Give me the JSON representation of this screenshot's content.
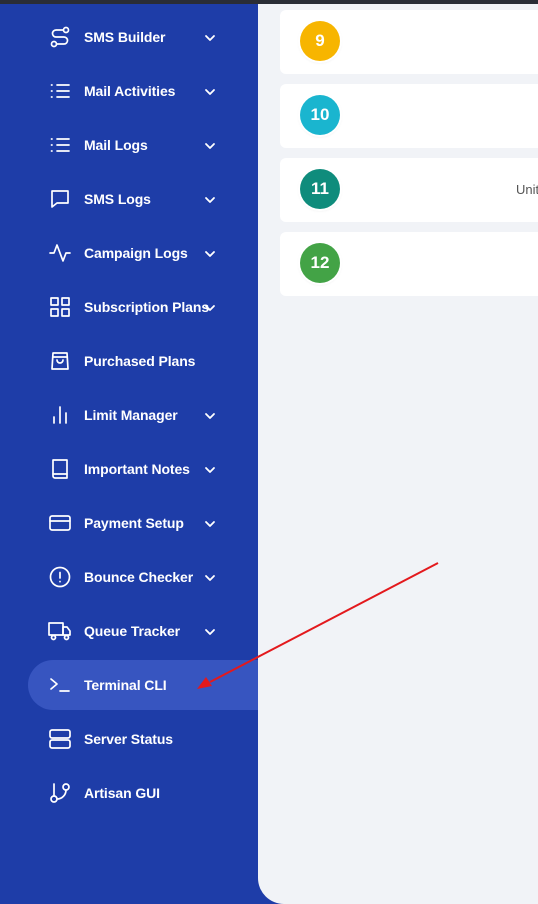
{
  "sidebar": {
    "items": [
      {
        "label": "SMS Builder",
        "icon": "route-icon",
        "has_chevron": true,
        "active": false
      },
      {
        "label": "Mail Activities",
        "icon": "list-icon",
        "has_chevron": true,
        "active": false
      },
      {
        "label": "Mail Logs",
        "icon": "list-icon",
        "has_chevron": true,
        "active": false
      },
      {
        "label": "SMS Logs",
        "icon": "message-square-icon",
        "has_chevron": true,
        "active": false
      },
      {
        "label": "Campaign Logs",
        "icon": "activity-icon",
        "has_chevron": true,
        "active": false
      },
      {
        "label": "Subscription Plans",
        "icon": "grid-icon",
        "has_chevron": true,
        "active": false
      },
      {
        "label": "Purchased Plans",
        "icon": "shopping-bag-icon",
        "has_chevron": false,
        "active": false
      },
      {
        "label": "Limit Manager",
        "icon": "bar-chart-icon",
        "has_chevron": true,
        "active": false
      },
      {
        "label": "Important Notes",
        "icon": "book-icon",
        "has_chevron": true,
        "active": false
      },
      {
        "label": "Payment Setup",
        "icon": "credit-card-icon",
        "has_chevron": true,
        "active": false
      },
      {
        "label": "Bounce Checker",
        "icon": "alert-circle-icon",
        "has_chevron": true,
        "active": false
      },
      {
        "label": "Queue Tracker",
        "icon": "truck-icon",
        "has_chevron": true,
        "active": false
      },
      {
        "label": "Terminal CLI",
        "icon": "terminal-icon",
        "has_chevron": false,
        "active": true
      },
      {
        "label": "Server Status",
        "icon": "server-icon",
        "has_chevron": false,
        "active": false
      },
      {
        "label": "Artisan GUI",
        "icon": "git-branch-icon",
        "has_chevron": false,
        "active": false
      }
    ]
  },
  "main": {
    "cards": [
      {
        "number": "9",
        "color": "#f7b500",
        "text": ""
      },
      {
        "number": "10",
        "color": "#1ab5cf",
        "text": ""
      },
      {
        "number": "11",
        "color": "#0f8c7c",
        "text": "Unit"
      },
      {
        "number": "12",
        "color": "#43a346",
        "text": ""
      }
    ]
  },
  "colors": {
    "sidebar_bg": "#1e3da8",
    "active_item_bg": "#3755c0",
    "main_bg": "#f1f3f7",
    "annotation_arrow": "#e3191d"
  }
}
